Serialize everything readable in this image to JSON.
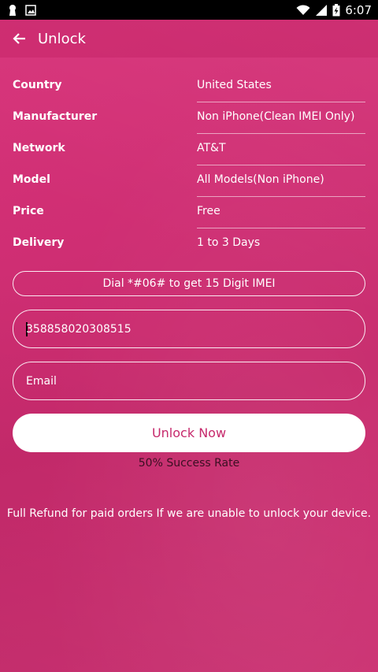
{
  "status_bar": {
    "time": "6:07",
    "icons": [
      "keyhole-icon",
      "image-icon",
      "wifi-icon",
      "signal-icon",
      "battery-charging-icon"
    ]
  },
  "app_bar": {
    "title": "Unlock",
    "back_icon": "arrow-left-icon"
  },
  "info": {
    "rows": [
      {
        "label": "Country",
        "value": "United States"
      },
      {
        "label": "Manufacturer",
        "value": "Non iPhone(Clean IMEI Only)"
      },
      {
        "label": "Network",
        "value": "AT&T"
      },
      {
        "label": "Model",
        "value": "All Models(Non iPhone)"
      },
      {
        "label": "Price",
        "value": "Free"
      },
      {
        "label": "Delivery",
        "value": "1 to 3 Days"
      }
    ]
  },
  "dial_button": {
    "label": "Dial *#06# to get 15 Digit IMEI"
  },
  "imei_input": {
    "value": "358858020308515"
  },
  "email_input": {
    "placeholder": "Email"
  },
  "unlock_button": {
    "label": "Unlock Now"
  },
  "success_rate": "50% Success Rate",
  "refund_note": "Full Refund for paid orders If we are unable to unlock your device.",
  "colors": {
    "accent": "#c6296c",
    "background": "#d2317a"
  }
}
